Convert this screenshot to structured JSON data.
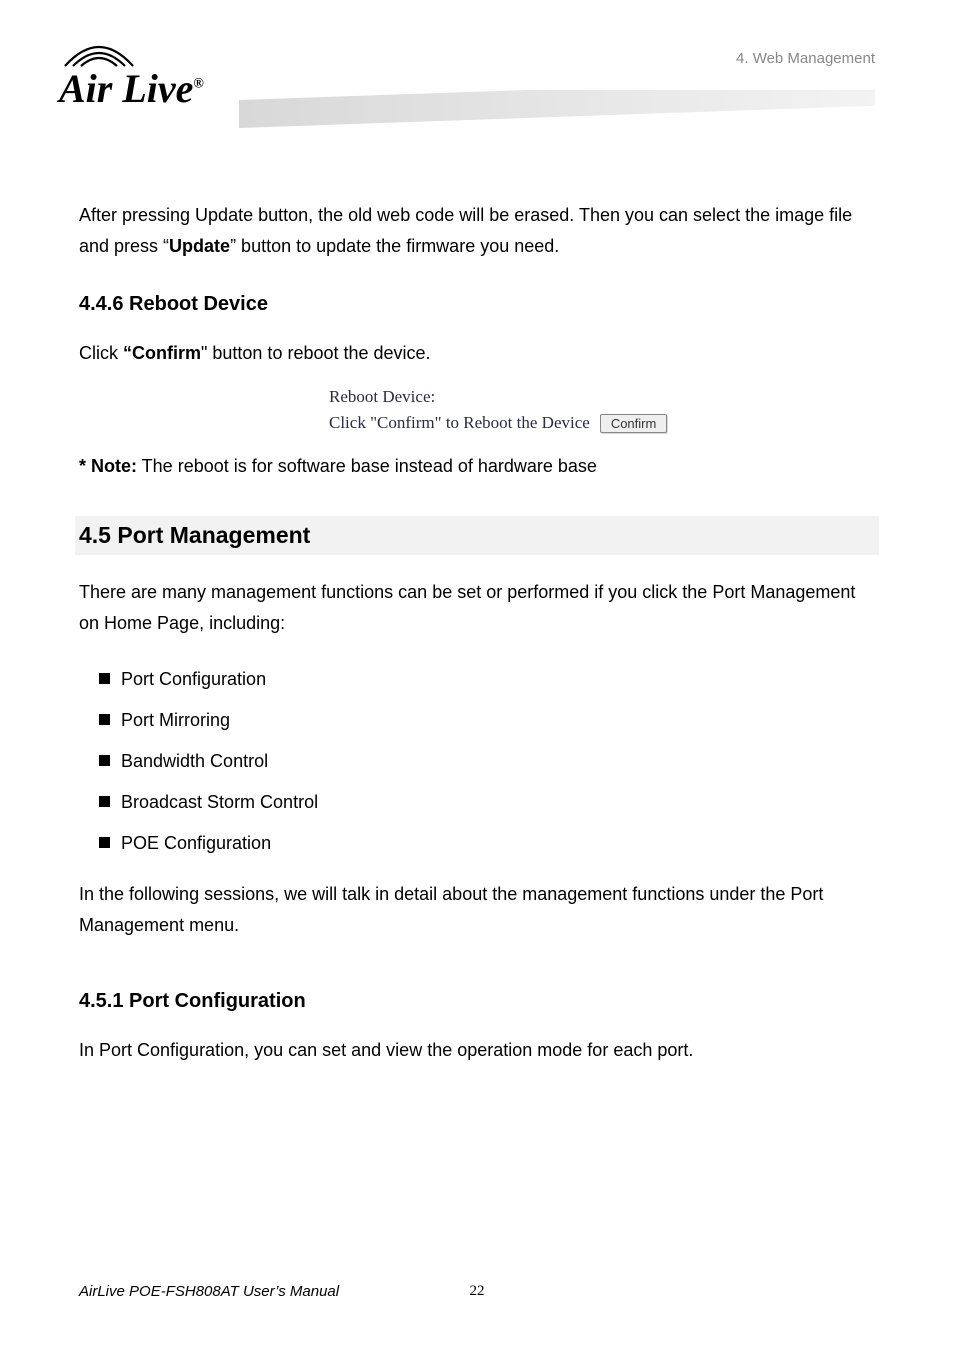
{
  "header": {
    "logo_text": "Air Live",
    "chapter_ref": "4.  Web  Management"
  },
  "intro": {
    "p1_part1": "After pressing Update button, the old web code will be erased. Then you can select the image file and press “",
    "p1_bold": "Update",
    "p1_part2": "” button to update the firmware you need."
  },
  "section_446": {
    "heading": "4.4.6 Reboot Device",
    "click_part1": "Click ",
    "click_bold": "“Confirm",
    "click_part2": "\" button to reboot the device.",
    "widget_line1": "Reboot Device:",
    "widget_line2": "Click \"Confirm\" to Reboot the Device",
    "confirm_label": "Confirm",
    "note_bold": "* Note:",
    "note_text": " The reboot is for software base instead of hardware base"
  },
  "section_45": {
    "heading": "4.5 Port Management",
    "intro": "There are many management functions can be set or performed if you click the Port Management on Home Page, including:",
    "items": [
      "Port Configuration",
      "Port Mirroring",
      "Bandwidth Control",
      "Broadcast Storm Control",
      "POE Configuration"
    ],
    "outro": "In the following sessions, we will talk in detail about the management functions under the Port Management menu."
  },
  "section_451": {
    "heading": "4.5.1 Port Configuration",
    "text": "In Port Configuration, you can set and view the operation mode for each port."
  },
  "footer": {
    "manual": "AirLive POE-FSH808AT User’s Manual",
    "page": "22"
  }
}
